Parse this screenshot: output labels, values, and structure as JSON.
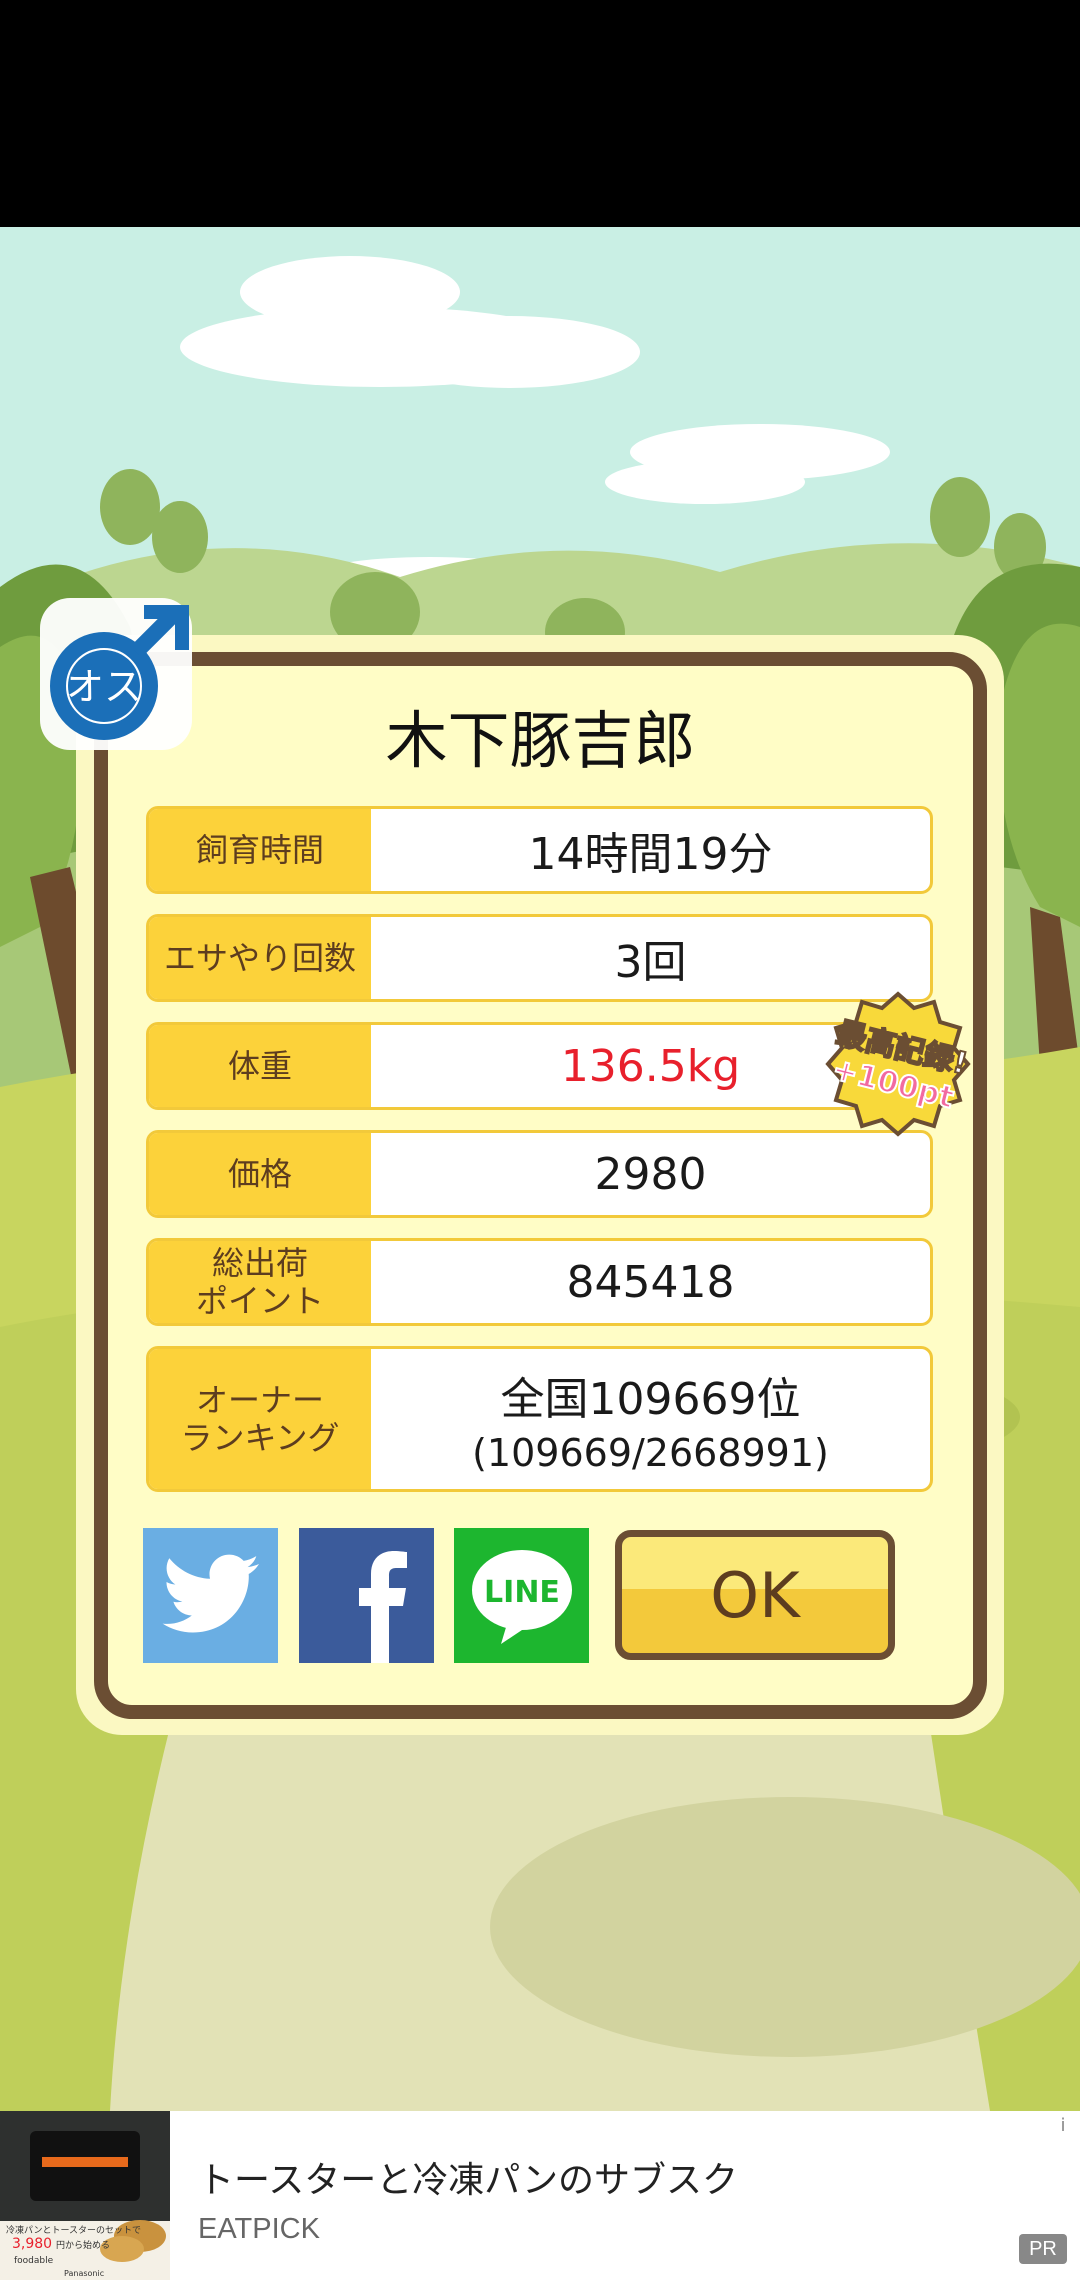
{
  "pig": {
    "name": "木下豚吉郎",
    "sex_label": "オス"
  },
  "stats": [
    {
      "label": "飼育時間",
      "value": "14時間19分"
    },
    {
      "label": "エサやり回数",
      "value": "3回"
    },
    {
      "label": "体重",
      "value": "136.5kg"
    },
    {
      "label": "価格",
      "value": "2980"
    },
    {
      "label": "総出荷\nポイント",
      "value": "845418"
    },
    {
      "label": "オーナー\nランキング",
      "value": "全国109669位",
      "sub": "(109669/2668991)"
    }
  ],
  "badge": {
    "line1": "最高記録!",
    "line2": "+100pt"
  },
  "share": {
    "line_label": "LINE"
  },
  "ok_label": "OK",
  "ad": {
    "title": "トースターと冷凍パンのサブスク",
    "advertiser": "EATPICK",
    "pr_label": "PR",
    "info_icon": "i",
    "thumb_text": "冷凍パンとトースターのセットで",
    "thumb_price": "3,980",
    "thumb_price_suffix": "円から始める",
    "thumb_brand": "foodable",
    "thumb_maker": "Panasonic"
  },
  "colors": {
    "accent_red": "#e8202c",
    "label_bg": "#fcd23a",
    "frame_brown": "#6b4e33",
    "twitter": "#6aaee3",
    "facebook": "#3b5b9b",
    "line": "#1db62f"
  }
}
